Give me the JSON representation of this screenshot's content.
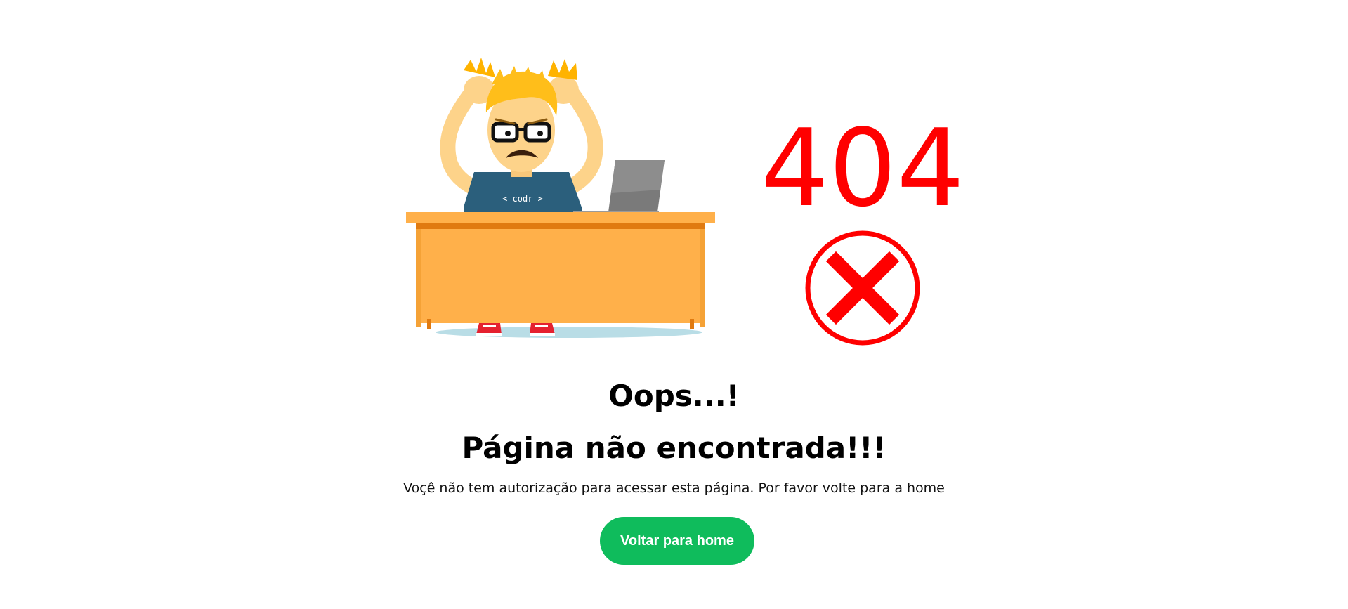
{
  "error": {
    "code": "404",
    "shirt_text": "< codr >",
    "code_color": "#ff0000"
  },
  "content": {
    "title": "Oops...!",
    "subtitle": "Página não encontrada!!!",
    "description": "Voçê não tem autorização para acessar esta página. Por favor volte para a home",
    "button_label": "Voltar para home"
  },
  "colors": {
    "button": "#0fbc5c",
    "desk": "#ffb04a",
    "error_red": "#ff0000"
  }
}
